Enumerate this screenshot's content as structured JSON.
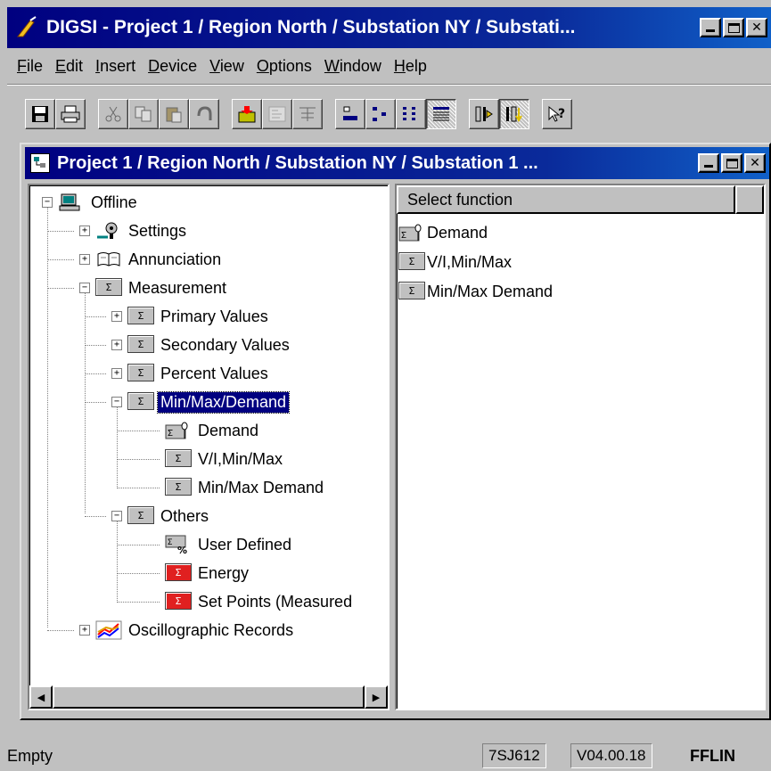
{
  "app": {
    "title": "DIGSI - Project 1 / Region North / Substation NY / Substati..."
  },
  "menu": {
    "items": [
      {
        "pre": "",
        "u": "F",
        "post": "ile"
      },
      {
        "pre": "",
        "u": "E",
        "post": "dit"
      },
      {
        "pre": "",
        "u": "I",
        "post": "nsert"
      },
      {
        "pre": "",
        "u": "D",
        "post": "evice"
      },
      {
        "pre": "",
        "u": "V",
        "post": "iew"
      },
      {
        "pre": "",
        "u": "O",
        "post": "ptions"
      },
      {
        "pre": "",
        "u": "W",
        "post": "indow"
      },
      {
        "pre": "",
        "u": "H",
        "post": "elp"
      }
    ]
  },
  "toolbar": {
    "groups": [
      [
        {
          "name": "save-icon"
        },
        {
          "name": "print-icon"
        }
      ],
      [
        {
          "name": "cut-icon",
          "disabled": true
        },
        {
          "name": "copy-icon",
          "disabled": true
        },
        {
          "name": "paste-icon",
          "disabled": true
        },
        {
          "name": "undo-icon",
          "disabled": true
        }
      ],
      [
        {
          "name": "device-icon"
        },
        {
          "name": "settings-grid-icon",
          "disabled": true
        },
        {
          "name": "table-icon",
          "disabled": true
        }
      ],
      [
        {
          "name": "large-icons-view-icon"
        },
        {
          "name": "small-icons-view-icon"
        },
        {
          "name": "list-view-icon"
        },
        {
          "name": "details-view-icon",
          "pressed": true
        }
      ],
      [
        {
          "name": "online-icon"
        },
        {
          "name": "offline-icon",
          "pressed": true
        }
      ],
      [
        {
          "name": "help-pointer-icon"
        }
      ]
    ]
  },
  "child_window": {
    "title": "Project 1 / Region North / Substation NY / Substation 1 ..."
  },
  "tree": {
    "items": [
      {
        "label": "Offline",
        "icon": "computer-icon"
      },
      {
        "label": "Settings",
        "icon": "settings-icon"
      },
      {
        "label": "Annunciation",
        "icon": "book-icon"
      },
      {
        "label": "Measurement",
        "icon": "measurement-icon"
      },
      {
        "label": "Primary Values",
        "icon": "measurement-icon"
      },
      {
        "label": "Secondary Values",
        "icon": "measurement-icon"
      },
      {
        "label": "Percent Values",
        "icon": "measurement-icon"
      },
      {
        "label": "Min/Max/Demand",
        "icon": "measurement-icon",
        "selected": true
      },
      {
        "label": "Demand",
        "icon": "demand-icon"
      },
      {
        "label": "V/I,Min/Max",
        "icon": "measurement-icon"
      },
      {
        "label": "Min/Max Demand",
        "icon": "measurement-icon"
      },
      {
        "label": "Others",
        "icon": "measurement-icon"
      },
      {
        "label": "User Defined",
        "icon": "user-defined-icon"
      },
      {
        "label": "Energy",
        "icon": "energy-icon"
      },
      {
        "label": "Set Points (Measured",
        "icon": "set-points-icon"
      },
      {
        "label": "Oscillographic Records",
        "icon": "chart-icon"
      }
    ]
  },
  "list": {
    "header": "Select function",
    "rows": [
      {
        "label": "Demand",
        "icon": "demand-icon"
      },
      {
        "label": "V/I,Min/Max",
        "icon": "measurement-icon"
      },
      {
        "label": "Min/Max Demand",
        "icon": "measurement-icon"
      }
    ]
  },
  "status": {
    "left": "Empty",
    "device": "7SJ612",
    "version": "V04.00.18",
    "mode": "FFLIN"
  }
}
